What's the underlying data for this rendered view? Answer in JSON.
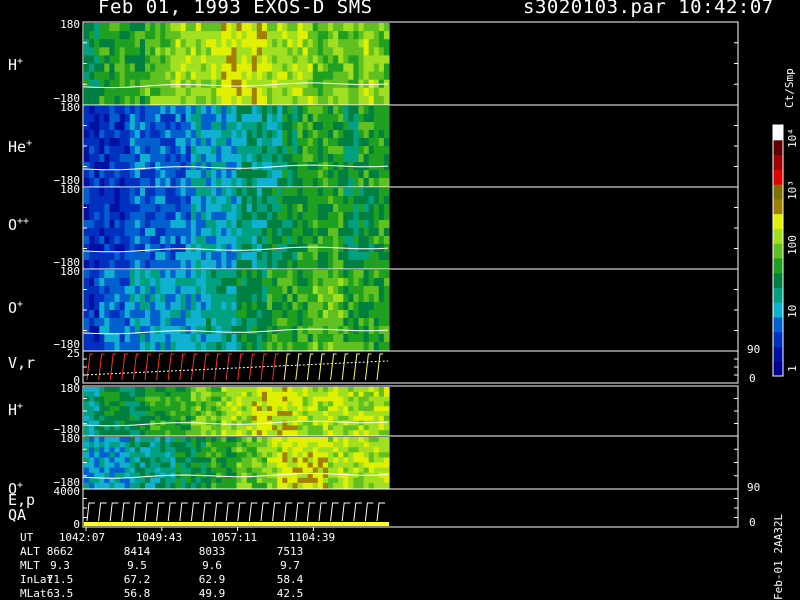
{
  "header": {
    "title": "Feb 01, 1993   EXOS-D SMS",
    "file_time": "s3020103.par  10:42:07"
  },
  "chart_data": {
    "type": "heatmap",
    "panels": [
      {
        "id": "hp1",
        "label": "H",
        "sup": "+",
        "y_top": "180",
        "y_bottom": "−180",
        "kind": "spectrogram",
        "level": [
          5,
          6,
          6,
          6,
          7,
          7,
          8,
          8,
          8,
          9,
          9,
          9,
          8,
          8,
          8,
          7,
          7,
          7,
          8,
          7
        ]
      },
      {
        "id": "hep",
        "label": "He",
        "sup": "+",
        "y_top": "180",
        "y_bottom": "−180",
        "kind": "spectrogram",
        "level": [
          1,
          1,
          1,
          2,
          2,
          2,
          2,
          3,
          3,
          3,
          4,
          4,
          4,
          5,
          6,
          6,
          6,
          5,
          6,
          6
        ]
      },
      {
        "id": "opp",
        "label": "O",
        "sup": "++",
        "y_top": "180",
        "y_bottom": "−180",
        "kind": "spectrogram",
        "level": [
          1,
          1,
          1,
          2,
          2,
          2,
          2,
          3,
          3,
          3,
          4,
          4,
          5,
          5,
          6,
          6,
          6,
          5,
          5,
          6
        ]
      },
      {
        "id": "op1",
        "label": "O",
        "sup": "+",
        "y_top": "180",
        "y_bottom": "−180",
        "kind": "spectrogram",
        "level": [
          1,
          2,
          2,
          3,
          3,
          3,
          3,
          3,
          4,
          4,
          5,
          5,
          6,
          6,
          6,
          7,
          7,
          6,
          6,
          6
        ]
      },
      {
        "id": "vr",
        "label": "V,r",
        "sup": "",
        "y_top": "25",
        "y_bottom": "0",
        "right_top": "90",
        "right_bottom": "0",
        "kind": "line"
      },
      {
        "id": "hp2",
        "label": "H",
        "sup": "+",
        "y_top": "180",
        "y_bottom": "−180",
        "kind": "spectrogram",
        "level": [
          4,
          5,
          5,
          5,
          6,
          6,
          6,
          7,
          7,
          8,
          8,
          9,
          9,
          9,
          8,
          8,
          8,
          8,
          8,
          8
        ]
      },
      {
        "id": "op2",
        "label": "O",
        "sup": "+",
        "y_top": "180",
        "y_bottom": "−180",
        "kind": "spectrogram",
        "level": [
          3,
          3,
          3,
          4,
          4,
          4,
          5,
          5,
          6,
          6,
          7,
          7,
          8,
          9,
          9,
          9,
          8,
          8,
          8,
          8
        ]
      },
      {
        "id": "ep",
        "label": "E,p",
        "sup": "",
        "sub_label": "QA",
        "y_top": "4000",
        "y_bottom": "0",
        "right_top": "90",
        "right_bottom": "0",
        "kind": "line"
      }
    ],
    "colorbar": {
      "unit": "Ct/Smp",
      "labels": [
        "10⁴",
        "10³",
        "100",
        "10",
        "1"
      ],
      "colors": [
        "#000090",
        "#0010a0",
        "#0030c0",
        "#0060d0",
        "#10b0d0",
        "#00a080",
        "#008040",
        "#20a020",
        "#60c020",
        "#a0e020",
        "#e0f000",
        "#a08000",
        "#807000",
        "#e00000",
        "#a00000",
        "#600000",
        "#ffffff"
      ]
    },
    "x_ticks": [
      "1042:07",
      "1049:43",
      "1057:11",
      "1104:39"
    ]
  },
  "ephemeris": {
    "rows": [
      {
        "name": "UT",
        "values": [
          "1042:07",
          "1049:43",
          "1057:11",
          "1104:39"
        ]
      },
      {
        "name": "ALT",
        "values": [
          "8662",
          "8414",
          "8033",
          "7513"
        ]
      },
      {
        "name": "MLT",
        "values": [
          "9.3",
          "9.5",
          "9.6",
          "9.7"
        ]
      },
      {
        "name": "InLat",
        "values": [
          "71.5",
          "67.2",
          "62.9",
          "58.4"
        ]
      },
      {
        "name": "MLat",
        "values": [
          "63.5",
          "56.8",
          "49.9",
          "42.5"
        ]
      }
    ]
  },
  "footer": "Feb-01 2AA32L"
}
